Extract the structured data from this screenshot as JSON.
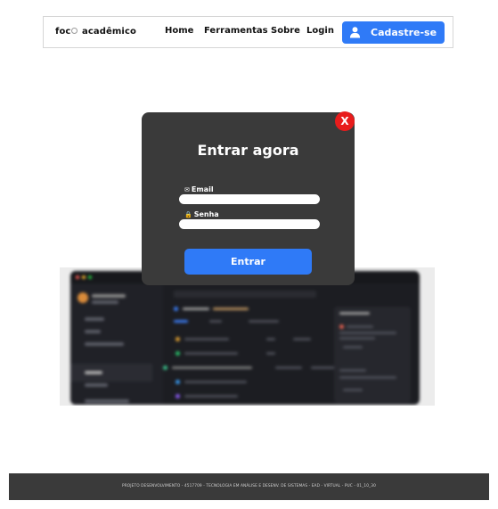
{
  "navbar": {
    "logo_prefix": "foc",
    "logo_suffix": "acadêmico",
    "links": [
      "Home",
      "Ferramentas",
      "Sobre",
      "Login"
    ],
    "signup_label": "Cadastre-se",
    "accent_color": "#2f7af7"
  },
  "modal": {
    "title": "Entrar agora",
    "close_label": "X",
    "email_label": "Email",
    "email_value": "",
    "password_label": "Senha",
    "password_value": "",
    "submit_label": "Entrar",
    "close_color": "#e81c1c"
  },
  "footer": {
    "text": "PROJETO DESENVOLVIMENTO - 4517709 - TECNOLOGIA EM ANÁLISE E DESENV. DE SISTEMAS - EAD - VIRTUAL - PUC - 01_10_30"
  }
}
